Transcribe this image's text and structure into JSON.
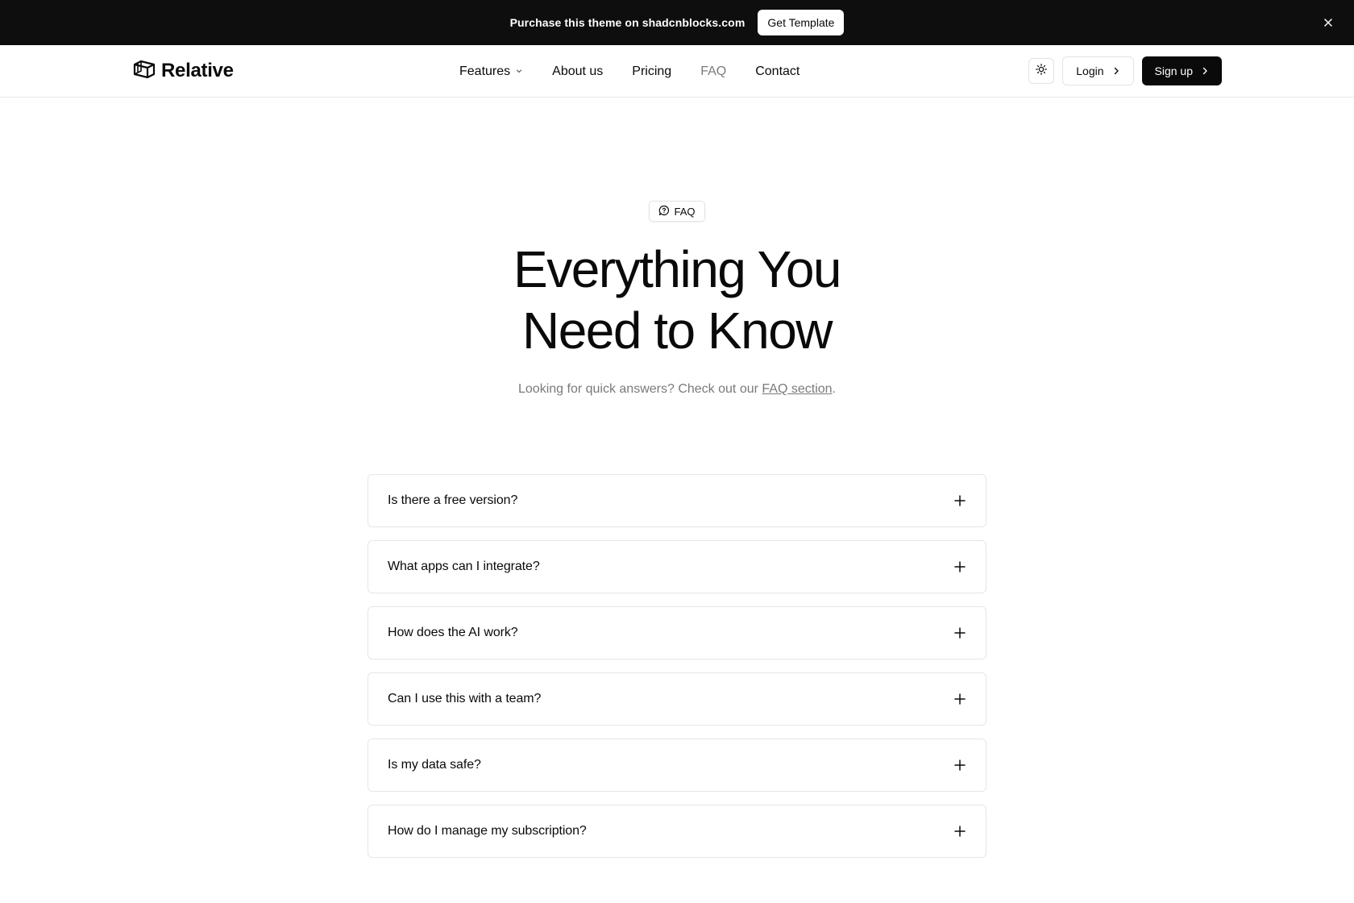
{
  "promo": {
    "text_prefix": "Purchase this theme on",
    "text_brand": "shadcnblocks.com",
    "button_label": "Get Template",
    "close_icon": "close-icon"
  },
  "navbar": {
    "logo_text": "Relative",
    "logo_icon": "box-logo-icon",
    "links": [
      {
        "label": "Features",
        "has_dropdown": true
      },
      {
        "label": "About us"
      },
      {
        "label": "Pricing"
      },
      {
        "label": "FAQ",
        "active": true
      },
      {
        "label": "Contact"
      }
    ],
    "theme_toggle_icon": "sun-icon",
    "login_label": "Login",
    "signup_label": "Sign up"
  },
  "hero": {
    "badge_label": "FAQ",
    "badge_icon": "chat-bubble-icon",
    "title_line1": "Everything You",
    "title_line2": "Need to Know",
    "subtitle_prefix": "Looking for quick answers? Check out our",
    "subtitle_link": "FAQ section",
    "subtitle_suffix": "."
  },
  "faq": {
    "items": [
      {
        "question": "Is there a free version?"
      },
      {
        "question": "What apps can I integrate?"
      },
      {
        "question": "How does the AI work?"
      },
      {
        "question": "Can I use this with a team?"
      },
      {
        "question": "Is my data safe?"
      },
      {
        "question": "How do I manage my subscription?"
      }
    ],
    "expand_icon": "plus-icon"
  },
  "colors": {
    "banner_bg": "#0e0e0f",
    "primary": "#0a0a0a",
    "muted_text": "#7a7a7a",
    "border": "#e6e6e6"
  }
}
